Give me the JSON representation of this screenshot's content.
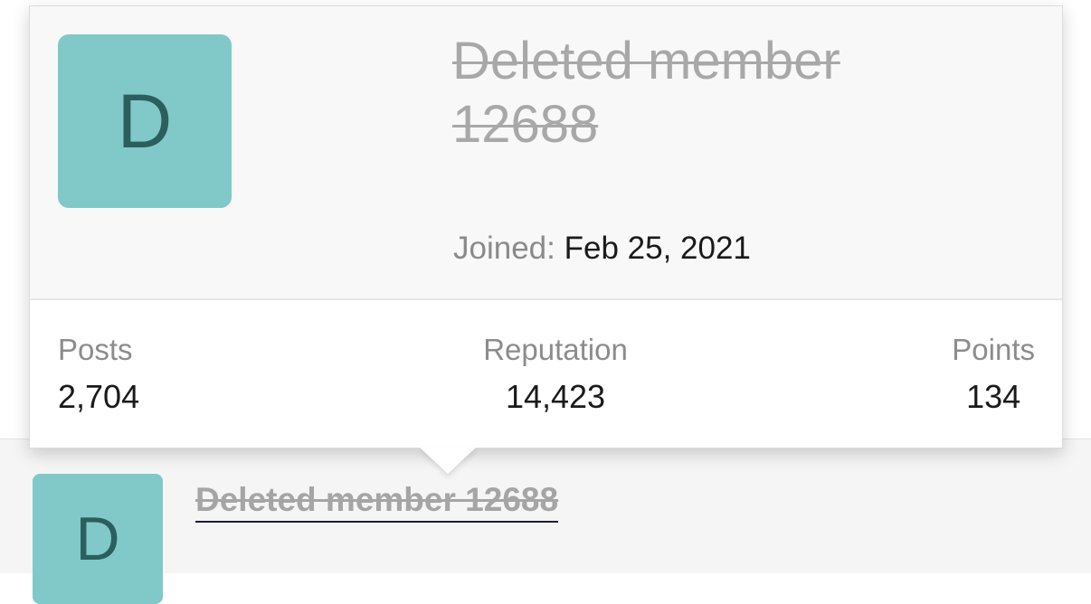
{
  "post": {
    "avatar_letter": "D",
    "username": "Deleted member 12688"
  },
  "tooltip": {
    "avatar_letter": "D",
    "username": "Deleted member 12688",
    "joined_label": "Joined:",
    "joined_value": "Feb 25, 2021",
    "stats": {
      "posts_label": "Posts",
      "posts_value": "2,704",
      "reputation_label": "Reputation",
      "reputation_value": "14,423",
      "points_label": "Points",
      "points_value": "134"
    }
  },
  "colors": {
    "avatar_bg": "#80c9c8",
    "avatar_text": "#2b5f5e",
    "deleted_text": "#a8a8a8",
    "label_text": "#8c8c8c",
    "value_text": "#1a1a1a"
  }
}
